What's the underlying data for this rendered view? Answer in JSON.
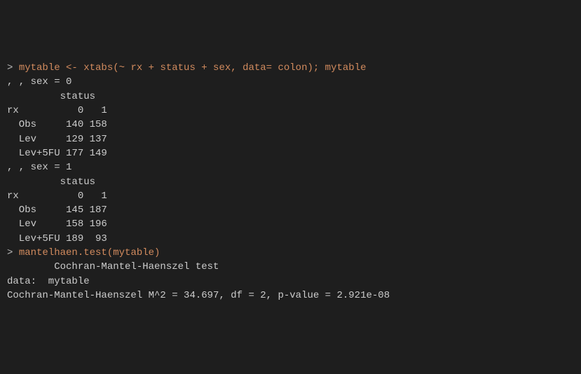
{
  "commands": {
    "cmd1": "mytable <- xtabs(~ rx + status + sex, data= colon); mytable",
    "cmd2": "mantelhaen.test(mytable)"
  },
  "prompt": "> ",
  "output_block1": {
    "l0": ", , sex = 0",
    "l1": "",
    "l2": "         status",
    "l3": "rx          0   1",
    "l4": "  Obs     140 158",
    "l5": "  Lev     129 137",
    "l6": "  Lev+5FU 177 149",
    "l7": "",
    "l8": ", , sex = 1",
    "l9": "",
    "l10": "         status",
    "l11": "rx          0   1",
    "l12": "  Obs     145 187",
    "l13": "  Lev     158 196",
    "l14": "  Lev+5FU 189  93",
    "l15": ""
  },
  "output_block2": {
    "l0": "",
    "l1": "        Cochran-Mantel-Haenszel test",
    "l2": "",
    "l3": "data:  mytable",
    "l4": "Cochran-Mantel-Haenszel M^2 = 34.697, df = 2, p-value = 2.921e-08"
  },
  "chart_data": {
    "type": "table",
    "title": "xtabs contingency table (~ rx + status + sex, data = colon)",
    "strata": [
      {
        "sex": 0,
        "columns": [
          "0",
          "1"
        ],
        "rows": [
          {
            "rx": "Obs",
            "values": [
              140,
              158
            ]
          },
          {
            "rx": "Lev",
            "values": [
              129,
              137
            ]
          },
          {
            "rx": "Lev+5FU",
            "values": [
              177,
              149
            ]
          }
        ]
      },
      {
        "sex": 1,
        "columns": [
          "0",
          "1"
        ],
        "rows": [
          {
            "rx": "Obs",
            "values": [
              145,
              187
            ]
          },
          {
            "rx": "Lev",
            "values": [
              158,
              196
            ]
          },
          {
            "rx": "Lev+5FU",
            "values": [
              189,
              93
            ]
          }
        ]
      }
    ],
    "test": {
      "name": "Cochran-Mantel-Haenszel test",
      "statistic": "M^2",
      "value": 34.697,
      "df": 2,
      "p_value": 2.921e-08
    }
  }
}
